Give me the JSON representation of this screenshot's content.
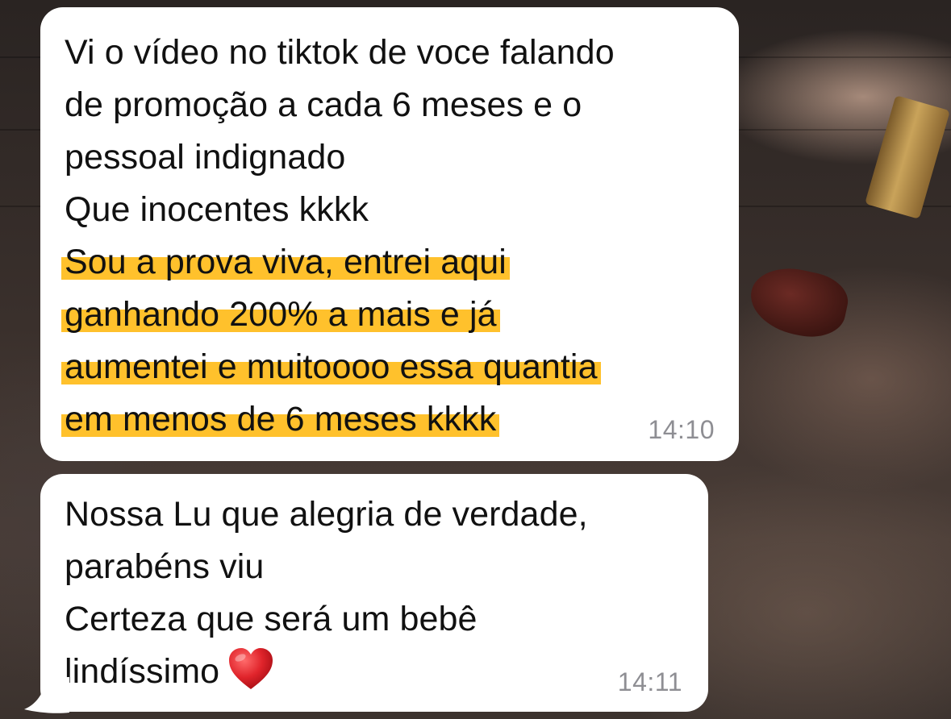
{
  "conversation": {
    "messages": [
      {
        "lines": [
          {
            "text": "Vi o vídeo no tiktok de voce falando",
            "highlighted": false
          },
          {
            "text": "de promoção a cada 6 meses e o",
            "highlighted": false
          },
          {
            "text": "pessoal indignado",
            "highlighted": false
          },
          {
            "text": "Que inocentes kkkk",
            "highlighted": false
          },
          {
            "text": "Sou a prova viva, entrei aqui",
            "highlighted": true
          },
          {
            "text": "ganhando 200% a mais e já",
            "highlighted": true
          },
          {
            "text": "aumentei e muitoooo essa quantia",
            "highlighted": true
          },
          {
            "text": "em menos de 6 meses kkkk",
            "highlighted": true
          }
        ],
        "time": "14:10"
      },
      {
        "lines": [
          {
            "text": "Nossa Lu que alegria de verdade,",
            "highlighted": false
          },
          {
            "text": "parabéns viu",
            "highlighted": false
          },
          {
            "text": "Certeza que será um bebê",
            "highlighted": false
          },
          {
            "text": "lindíssimo",
            "highlighted": false
          }
        ],
        "emoji": "red-heart",
        "time": "14:11"
      }
    ]
  },
  "colors": {
    "bubble": "#ffffff",
    "highlight": "#ffc12c",
    "text": "#111111",
    "timestamp": "#8e8e93",
    "heart": "#e0242b"
  }
}
